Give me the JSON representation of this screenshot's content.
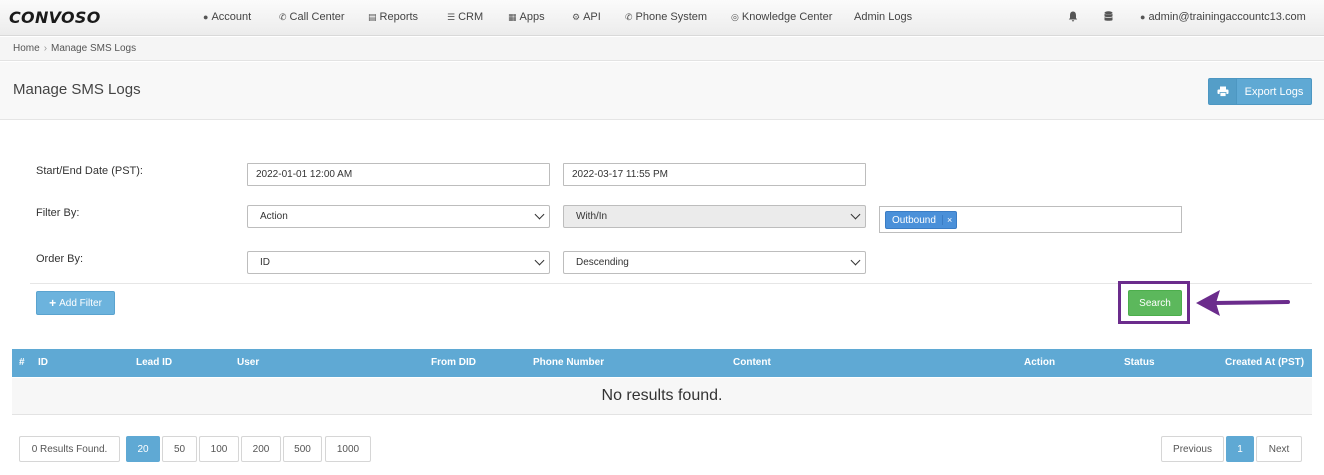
{
  "nav": {
    "logo": "CONVOSO",
    "items": [
      {
        "label": "Account",
        "icon": "user-icon"
      },
      {
        "label": "Call Center",
        "icon": "phone-icon"
      },
      {
        "label": "Reports",
        "icon": "bar-chart-icon"
      },
      {
        "label": "CRM",
        "icon": "list-icon"
      },
      {
        "label": "Apps",
        "icon": "grid-icon"
      },
      {
        "label": "API",
        "icon": "gear-icon"
      },
      {
        "label": "Phone System",
        "icon": "phone-icon"
      },
      {
        "label": "Knowledge Center",
        "icon": "lightbulb-icon"
      },
      {
        "label": "Admin Logs",
        "icon": ""
      }
    ],
    "user": "admin@trainingaccountc13.com"
  },
  "breadcrumb": {
    "home": "Home",
    "sep": "›",
    "current": "Manage SMS Logs"
  },
  "header": {
    "title": "Manage SMS Logs",
    "export_label": "Export Logs"
  },
  "form": {
    "date_label": "Start/End Date (PST):",
    "start_date": "2022-01-01 12:00 AM",
    "end_date": "2022-03-17 11:55 PM",
    "filter_label": "Filter By:",
    "filter_field": "Action",
    "filter_operator": "With/In",
    "filter_tag": "Outbound",
    "filter_tag_remove": "×",
    "order_label": "Order By:",
    "order_field": "ID",
    "order_direction": "Descending",
    "add_filter_label": "Add Filter",
    "add_filter_plus": "+",
    "search_label": "Search"
  },
  "table": {
    "columns": [
      "#",
      "ID",
      "Lead ID",
      "User",
      "From DID",
      "Phone Number",
      "Content",
      "Action",
      "Status",
      "Created At (PST)"
    ],
    "empty_message": "No results found."
  },
  "pagination": {
    "results_found": "0 Results Found.",
    "page_sizes": [
      "20",
      "50",
      "100",
      "200",
      "500",
      "1000"
    ],
    "active_page_size": "20",
    "previous": "Previous",
    "current_page": "1",
    "next": "Next"
  },
  "colors": {
    "accent": "#5fa9d4",
    "search": "#5cb85c",
    "highlight": "#6b2c8c",
    "tag": "#4a90d9"
  }
}
